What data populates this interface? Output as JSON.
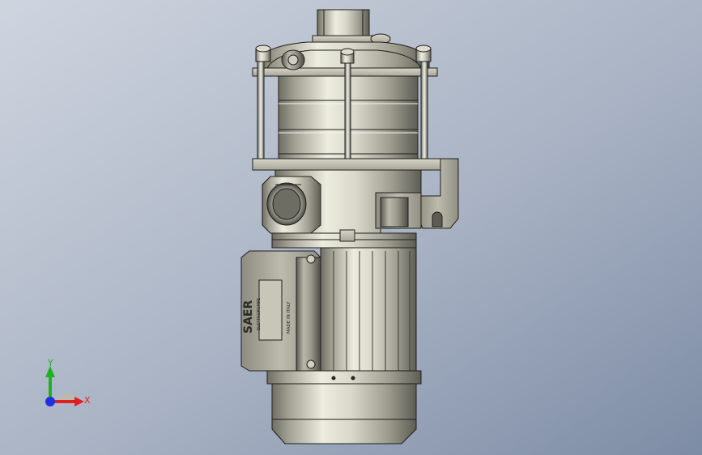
{
  "view": {
    "background_top": "#c9d0db",
    "background_bottom": "#7f8ea6",
    "metal_light": "#e8e8dc",
    "metal_mid": "#b8b7a8",
    "metal_dark": "#7d7c70",
    "edge": "#1e1e1e"
  },
  "model": {
    "brand_text": "SAER",
    "brand_sub": "ELETTROPOMPE",
    "plate_text": "MADE IN ITALY"
  },
  "triad": {
    "x_label": "X",
    "y_label": "Y",
    "x_color": "#e02020",
    "y_color": "#20b020",
    "z_color": "#2030e0"
  }
}
